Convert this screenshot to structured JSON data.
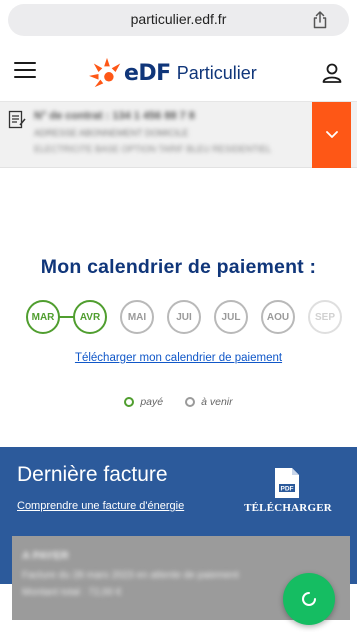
{
  "browser": {
    "url": "particulier.edf.fr"
  },
  "header": {
    "logo_brand": "eDF",
    "logo_product": "Particulier"
  },
  "contract": {
    "line1": "N° de contrat : 134 1 456 88 7 8",
    "line2": "ADRESSE ABONNEMENT DOMICILE",
    "line3": "ELECTRICITE BASE OPTION TARIF BLEU RESIDENTIEL"
  },
  "calendar": {
    "title": "Mon calendrier de paiement :",
    "months": [
      {
        "label": "MAR",
        "status": "paid"
      },
      {
        "label": "AVR",
        "status": "paid"
      },
      {
        "label": "MAI",
        "status": "upcoming"
      },
      {
        "label": "JUI",
        "status": "upcoming"
      },
      {
        "label": "JUL",
        "status": "upcoming"
      },
      {
        "label": "AOU",
        "status": "upcoming"
      },
      {
        "label": "SEP",
        "status": "upcoming"
      }
    ],
    "download_link": "Télécharger mon calendrier de paiement",
    "legend_paid": "payé",
    "legend_upcoming": "à venir"
  },
  "invoice": {
    "title": "Dernière facture",
    "understand_link": "Comprendre une facture d'énergie",
    "pdf_label": "PDF",
    "download_label": "TÉLÉCHARGER",
    "card_line1": "A PAYER",
    "card_line2": "Facture du 28 mars 2023 en attente de paiement",
    "card_line3": "Montant total : 72,00 €"
  },
  "colors": {
    "brand_blue": "#10367a",
    "paid_green": "#509e2f",
    "accent_orange": "#fe5716",
    "invoice_bg": "#2c5a9b",
    "fab_green": "#15bd62"
  }
}
